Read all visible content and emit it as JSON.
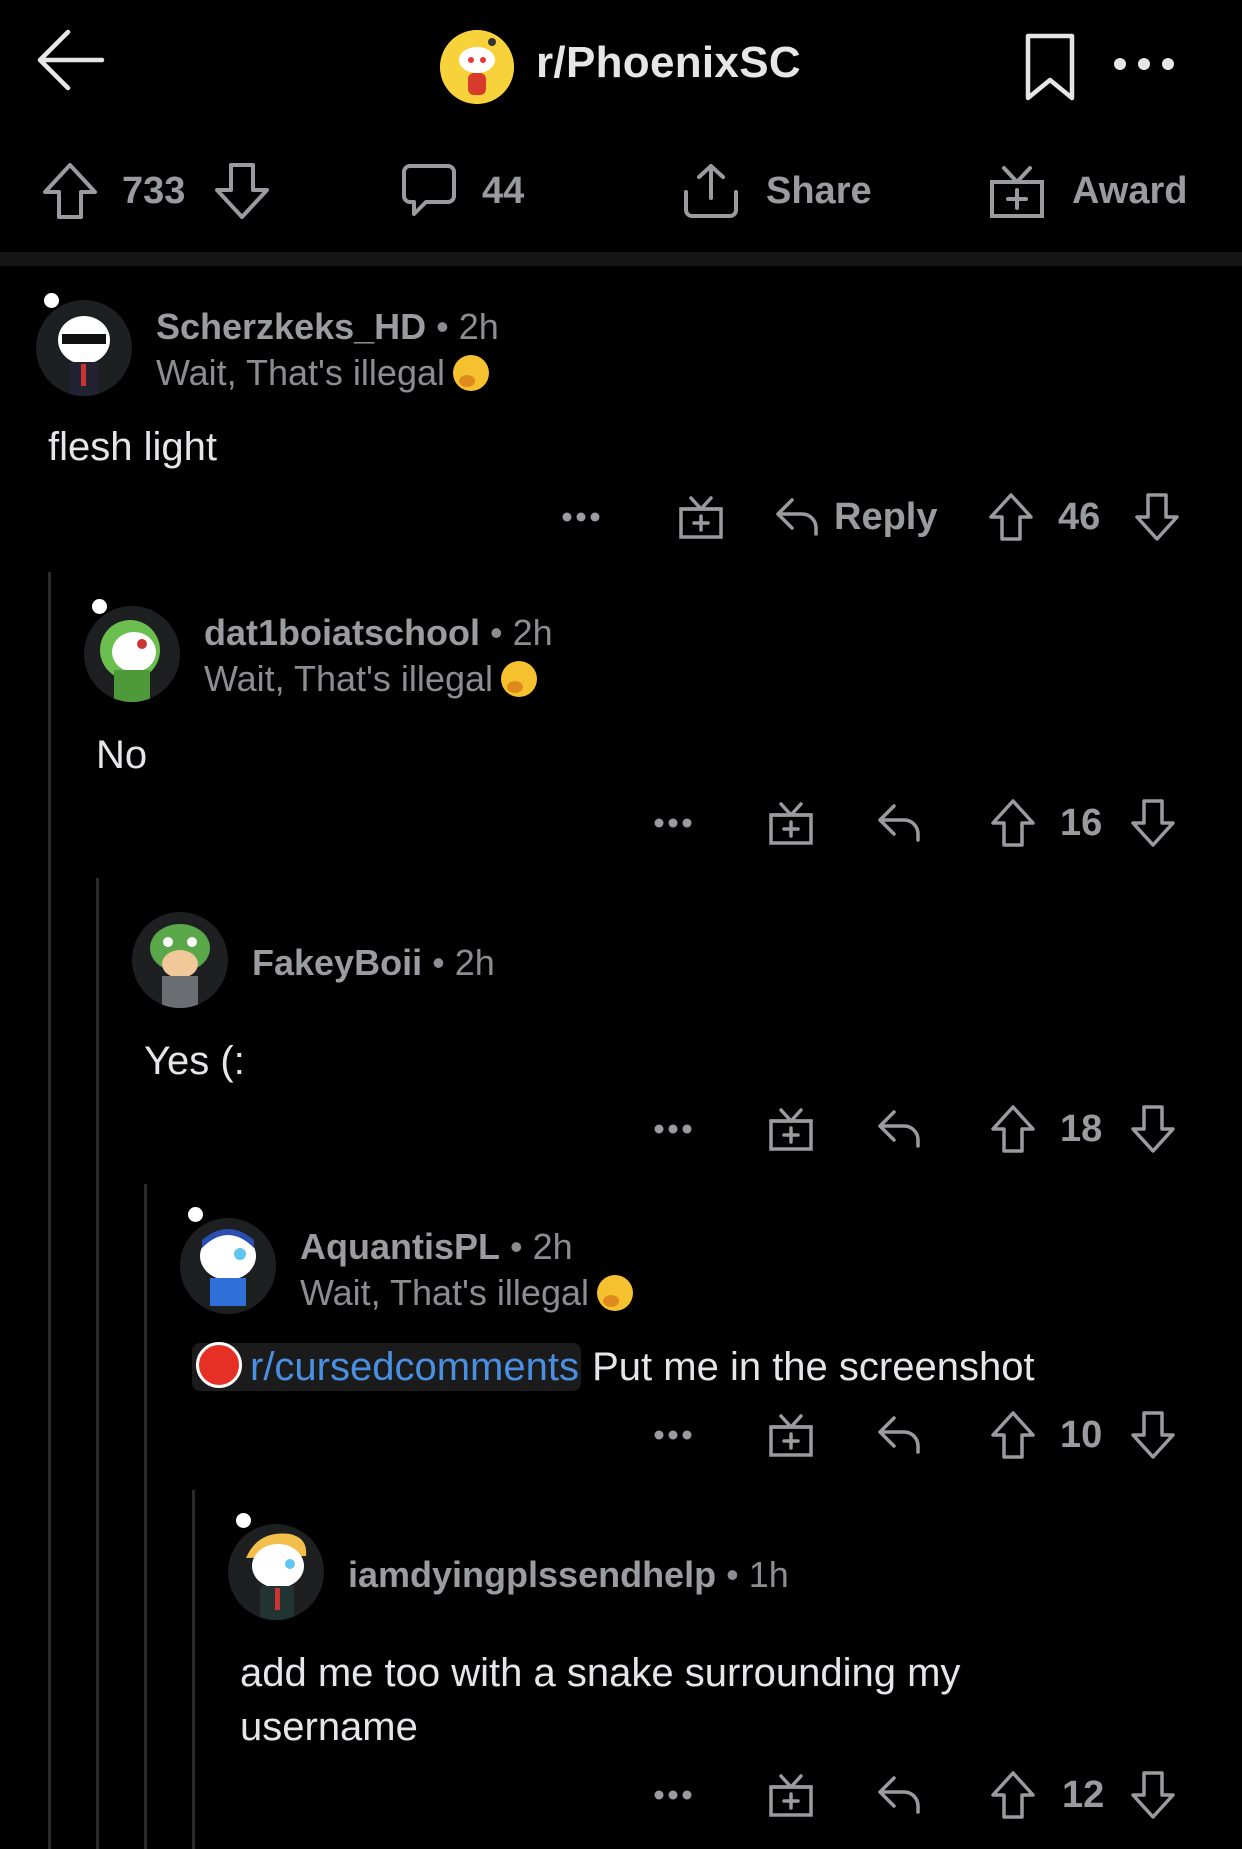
{
  "header": {
    "subreddit": "r/PhoenixSC"
  },
  "action_bar": {
    "votes": "733",
    "comments": "44",
    "share_label": "Share",
    "award_label": "Award"
  },
  "comments": [
    {
      "username": "Scherzkeks_HD",
      "age": "2h",
      "flair": "Wait, That's illegal",
      "body": "flesh light",
      "reply_label": "Reply",
      "score": "46"
    },
    {
      "username": "dat1boiatschool",
      "age": "2h",
      "flair": "Wait, That's illegal",
      "body": "No",
      "score": "16"
    },
    {
      "username": "FakeyBoii",
      "age": "2h",
      "body": "Yes (:",
      "score": "18"
    },
    {
      "username": "AquantisPL",
      "age": "2h",
      "flair": "Wait, That's illegal",
      "subreddit_link": "r/cursedcomments",
      "body": "Put me in the screenshot",
      "score": "10"
    },
    {
      "username": "iamdyingplssendhelp",
      "age": "1h",
      "body_line1": "add me too with a snake surrounding my",
      "body_line2": "username",
      "score": "12"
    }
  ],
  "colors": {
    "background": "#000000",
    "text_muted": "#9a9b9e",
    "link": "#4a90e2",
    "subreddit_icon": "#f7d23a"
  }
}
